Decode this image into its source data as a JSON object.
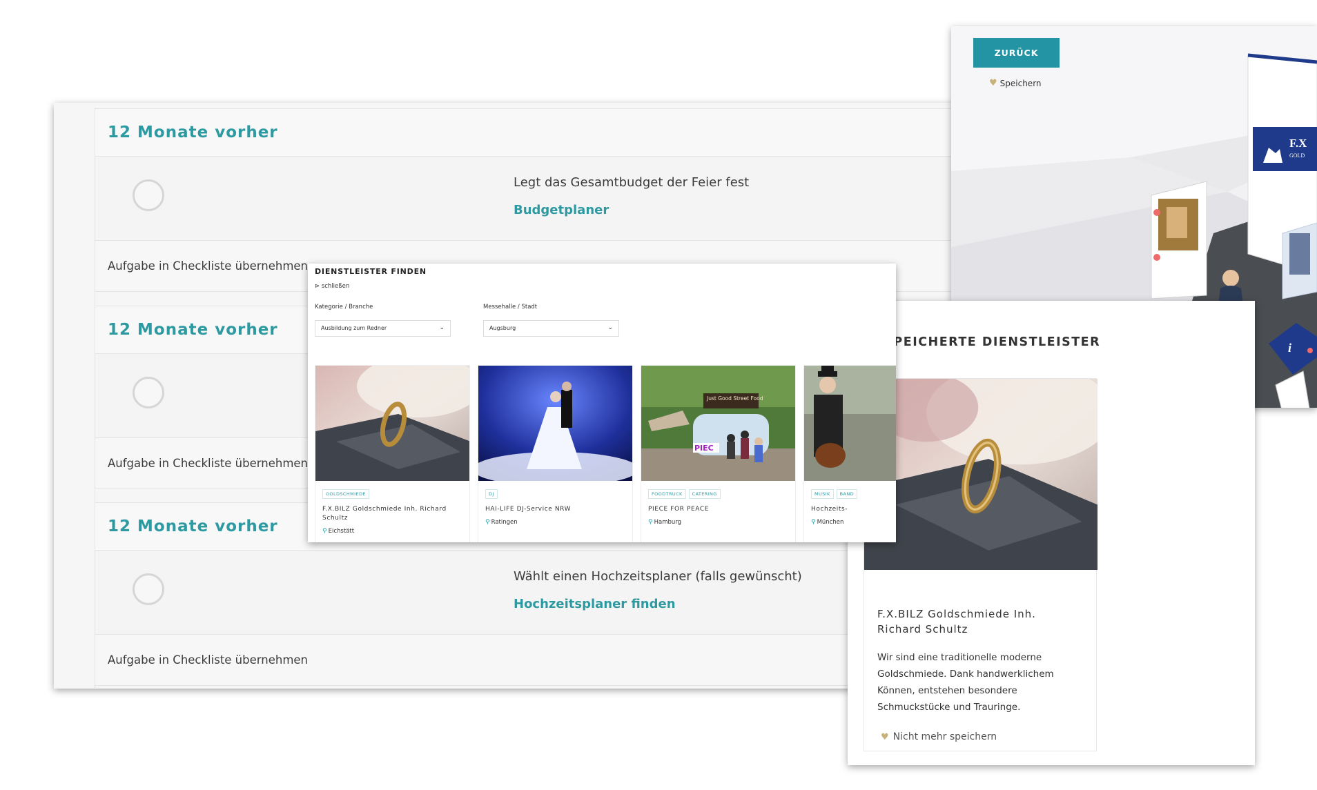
{
  "checklist": {
    "sections": [
      {
        "heading": "12 Monate vorher",
        "task": "Legt das Gesamtbudget der Feier fest",
        "link": "Budgetplaner",
        "action": "Aufgabe in Checkliste übernehmen"
      },
      {
        "heading": "12 Monate vorher",
        "task": "",
        "link": "",
        "action": "Aufgabe in Checkliste übernehmen"
      },
      {
        "heading": "12 Monate vorher",
        "task": "Wählt einen Hochzeitsplaner (falls gewünscht)",
        "link": "Hochzeitsplaner finden",
        "action": "Aufgabe in Checkliste übernehmen"
      }
    ]
  },
  "exhibition": {
    "back_label": "ZURÜCK",
    "save_label": "Speichern",
    "booth_logo": "F.X",
    "booth_sub": "GOLD"
  },
  "finder": {
    "title": "DIENSTLEISTER FINDEN",
    "close_label": "schließen",
    "category_label": "Kategorie / Branche",
    "category_value": "Ausbildung zum Redner",
    "city_label": "Messehalle / Stadt",
    "city_value": "Augsburg",
    "cards": [
      {
        "tags": [
          "GOLDSCHMIEDE"
        ],
        "name": "F.X.BILZ Goldschmiede Inh. Richard Schultz",
        "location": "Eichstätt"
      },
      {
        "tags": [
          "DJ"
        ],
        "name": "HAI-LIFE DJ-Service NRW",
        "location": "Ratingen"
      },
      {
        "tags": [
          "FOODTRUCK",
          "CATERING"
        ],
        "name": "PIECE FOR PEACE",
        "location": "Hamburg",
        "truck_sign": "Just Good Street Food",
        "truck_brand": "PIEC"
      },
      {
        "tags": [
          "MUSIK",
          "BAND"
        ],
        "name": "Hochzeits-",
        "location": "München"
      }
    ]
  },
  "saved": {
    "title": "GESPEICHERTE DIENSTLEISTER",
    "name": "F.X.BILZ Goldschmiede Inh. Richard Schultz",
    "description": "Wir sind eine traditionelle moderne Goldschmiede. Dank handwerklichem Können, entstehen besondere Schmuckstücke und Trauringe.",
    "unsave_label": "Nicht mehr speichern"
  },
  "colors": {
    "accent": "#2d9aa2",
    "button": "#2394a4",
    "heart": "#c8b27a"
  },
  "icons": [
    "radio-circle-icon",
    "heart-icon",
    "location-pin-icon",
    "chevron-down-icon",
    "close-icon"
  ]
}
